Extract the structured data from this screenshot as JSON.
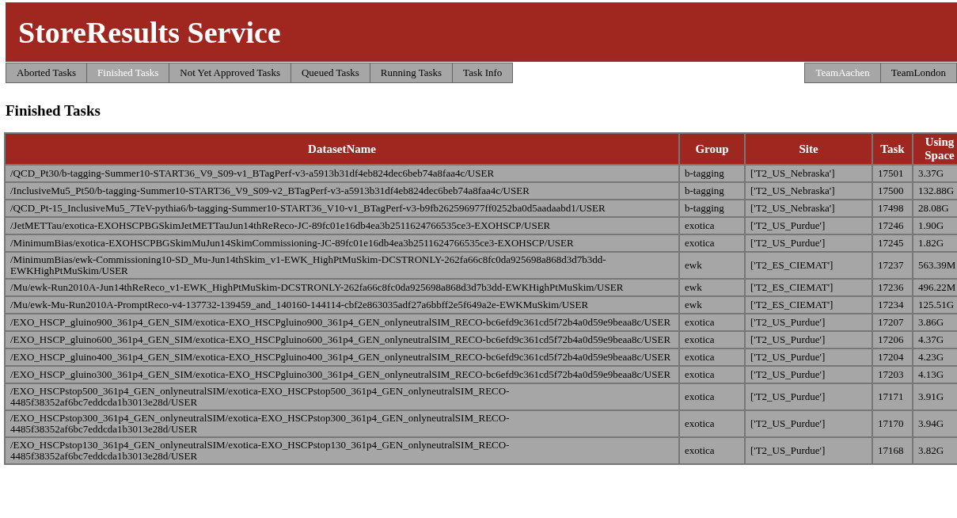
{
  "header": {
    "title": "StoreResults Service"
  },
  "tabs": [
    {
      "label": "Aborted Tasks",
      "selected": false
    },
    {
      "label": "Finished Tasks",
      "selected": true
    },
    {
      "label": "Not Yet Approved Tasks",
      "selected": false
    },
    {
      "label": "Queued Tasks",
      "selected": false
    },
    {
      "label": "Running Tasks",
      "selected": false
    },
    {
      "label": "Task Info",
      "selected": false
    }
  ],
  "team_tabs": [
    {
      "label": "TeamAachen",
      "selected": true
    },
    {
      "label": "TeamLondon",
      "selected": false
    }
  ],
  "section_title": "Finished Tasks",
  "table": {
    "columns": [
      "DatasetName",
      "Group",
      "Site",
      "Task",
      "Using Space"
    ],
    "rows": [
      [
        "/QCD_Pt30/b-tagging-Summer10-START36_V9_S09-v1_BTagPerf-v3-a5913b31df4eb824dec6beb74a8faa4c/USER",
        "b-tagging",
        "['T2_US_Nebraska']",
        "17501",
        "3.37G"
      ],
      [
        "/InclusiveMu5_Pt50/b-tagging-Summer10-START36_V9_S09-v2_BTagPerf-v3-a5913b31df4eb824dec6beb74a8faa4c/USER",
        "b-tagging",
        "['T2_US_Nebraska']",
        "17500",
        "132.88G"
      ],
      [
        "/QCD_Pt-15_InclusiveMu5_7TeV-pythia6/b-tagging-Summer10-START36_V10-v1_BTagPerf-v3-b9fb262596977ff0252ba0d5aadaabd1/USER",
        "b-tagging",
        "['T2_US_Nebraska']",
        "17498",
        "28.08G"
      ],
      [
        "/JetMETTau/exotica-EXOHSCPBGSkimJetMETTauJun14thReReco-JC-89fc01e16db4ea3b2511624766535ce3-EXOHSCP/USER",
        "exotica",
        "['T2_US_Purdue']",
        "17246",
        "1.90G"
      ],
      [
        "/MinimumBias/exotica-EXOHSCPBGSkimMuJun14SkimCommissioning-JC-89fc01e16db4ea3b2511624766535ce3-EXOHSCP/USER",
        "exotica",
        "['T2_US_Purdue']",
        "17245",
        "1.82G"
      ],
      [
        "/MinimumBias/ewk-Commissioning10-SD_Mu-Jun14thSkim_v1-EWK_HighPtMuSkim-DCSTRONLY-262fa66c8fc0da925698a868d3d7b3dd-EWKHighPtMuSkim/USER",
        "ewk",
        "['T2_ES_CIEMAT']",
        "17237",
        "563.39M"
      ],
      [
        "/Mu/ewk-Run2010A-Jun14thReReco_v1-EWK_HighPtMuSkim-DCSTRONLY-262fa66c8fc0da925698a868d3d7b3dd-EWKHighPtMuSkim/USER",
        "ewk",
        "['T2_ES_CIEMAT']",
        "17236",
        "496.22M"
      ],
      [
        "/Mu/ewk-Mu-Run2010A-PromptReco-v4-137732-139459_and_140160-144114-cbf2e863035adf27a6bbff2e5f649a2e-EWKMuSkim/USER",
        "ewk",
        "['T2_ES_CIEMAT']",
        "17234",
        "125.51G"
      ],
      [
        "/EXO_HSCP_gluino900_361p4_GEN_SIM/exotica-EXO_HSCPgluino900_361p4_GEN_onlyneutralSIM_RECO-bc6efd9c361cd5f72b4a0d59e9beaa8c/USER",
        "exotica",
        "['T2_US_Purdue']",
        "17207",
        "3.86G"
      ],
      [
        "/EXO_HSCP_gluino600_361p4_GEN_SIM/exotica-EXO_HSCPgluino600_361p4_GEN_onlyneutralSIM_RECO-bc6efd9c361cd5f72b4a0d59e9beaa8c/USER",
        "exotica",
        "['T2_US_Purdue']",
        "17206",
        "4.37G"
      ],
      [
        "/EXO_HSCP_gluino400_361p4_GEN_SIM/exotica-EXO_HSCPgluino400_361p4_GEN_onlyneutralSIM_RECO-bc6efd9c361cd5f72b4a0d59e9beaa8c/USER",
        "exotica",
        "['T2_US_Purdue']",
        "17204",
        "4.23G"
      ],
      [
        "/EXO_HSCP_gluino300_361p4_GEN_SIM/exotica-EXO_HSCPgluino300_361p4_GEN_onlyneutralSIM_RECO-bc6efd9c361cd5f72b4a0d59e9beaa8c/USER",
        "exotica",
        "['T2_US_Purdue']",
        "17203",
        "4.13G"
      ],
      [
        "/EXO_HSCPstop500_361p4_GEN_onlyneutralSIM/exotica-EXO_HSCPstop500_361p4_GEN_onlyneutralSIM_RECO-4485f38352af6bc7eddcda1b3013e28d/USER",
        "exotica",
        "['T2_US_Purdue']",
        "17171",
        "3.91G"
      ],
      [
        "/EXO_HSCPstop300_361p4_GEN_onlyneutralSIM/exotica-EXO_HSCPstop300_361p4_GEN_onlyneutralSIM_RECO-4485f38352af6bc7eddcda1b3013e28d/USER",
        "exotica",
        "['T2_US_Purdue']",
        "17170",
        "3.94G"
      ],
      [
        "/EXO_HSCPstop130_361p4_GEN_onlyneutralSIM/exotica-EXO_HSCPstop130_361p4_GEN_onlyneutralSIM_RECO-4485f38352af6bc7eddcda1b3013e28d/USER",
        "exotica",
        "['T2_US_Purdue']",
        "17168",
        "3.82G"
      ]
    ]
  }
}
